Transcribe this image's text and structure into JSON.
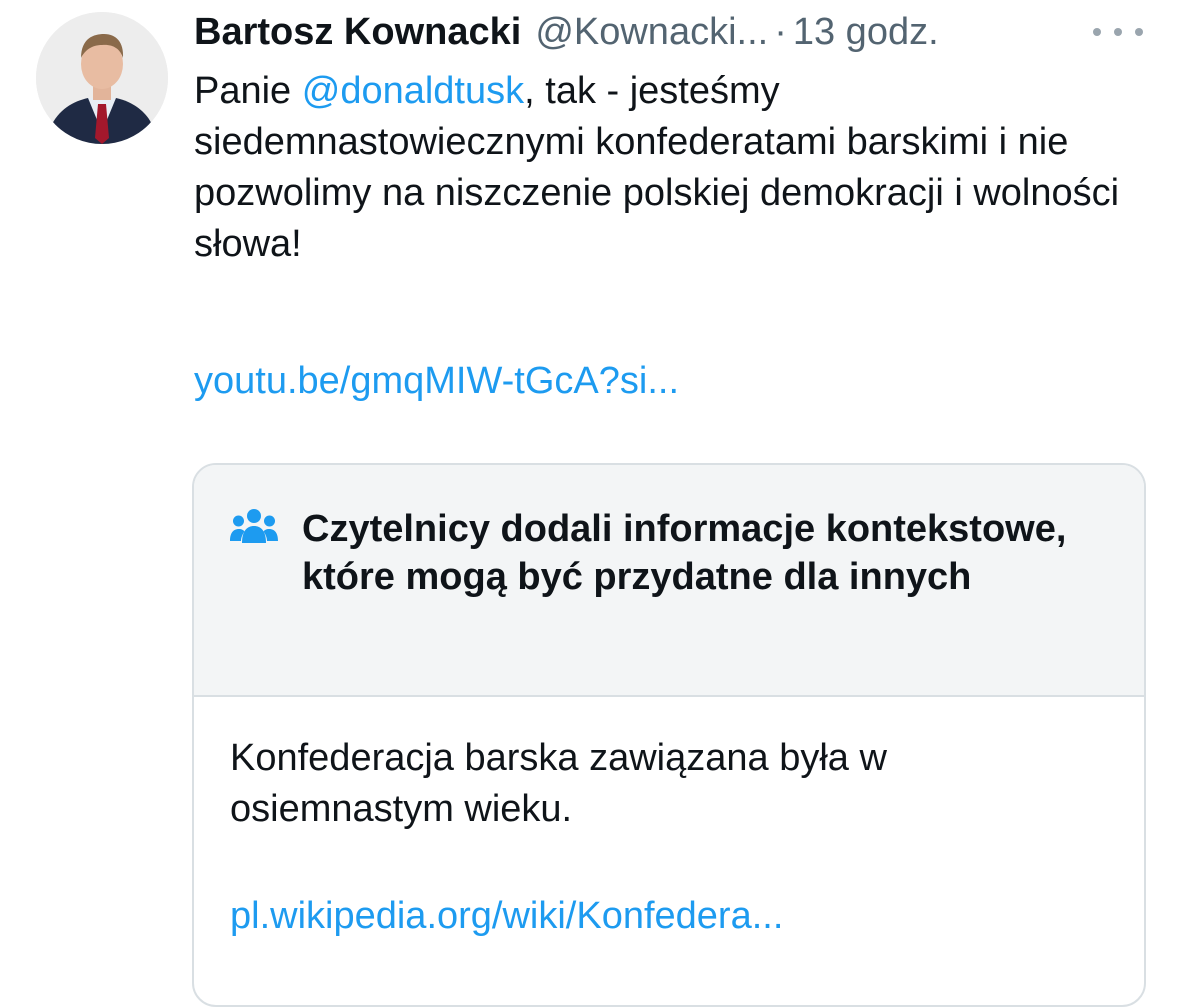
{
  "tweet": {
    "author_name": "Bartosz Kownacki",
    "handle": "@Kownacki...",
    "separator": "·",
    "time": "13 godz.",
    "text_before_mention": "Panie ",
    "mention": "@donaldtusk",
    "text_after_mention": ", tak - jesteśmy siedemnastowiecznymi konfederatami barskimi i nie pozwolimy na niszczenie polskiej demokracji i wolności słowa!",
    "link": "youtu.be/gmqMIW-tGcA?si..."
  },
  "community_note": {
    "title": "Czytelnicy dodali informacje kontekstowe, które mogą być przydatne dla innych",
    "body": "Konfederacja barska zawiązana była w osiemnastym wieku.",
    "link": "pl.wikipedia.org/wiki/Konfedera..."
  },
  "icons": {
    "avatar": "profile-photo",
    "more": "more-options-icon",
    "note": "people-icon"
  },
  "colors": {
    "text": "#0f1419",
    "secondary": "#536471",
    "link": "#1d9bf0",
    "note_header_bg": "#f3f5f6",
    "border": "#d9dfe3"
  }
}
